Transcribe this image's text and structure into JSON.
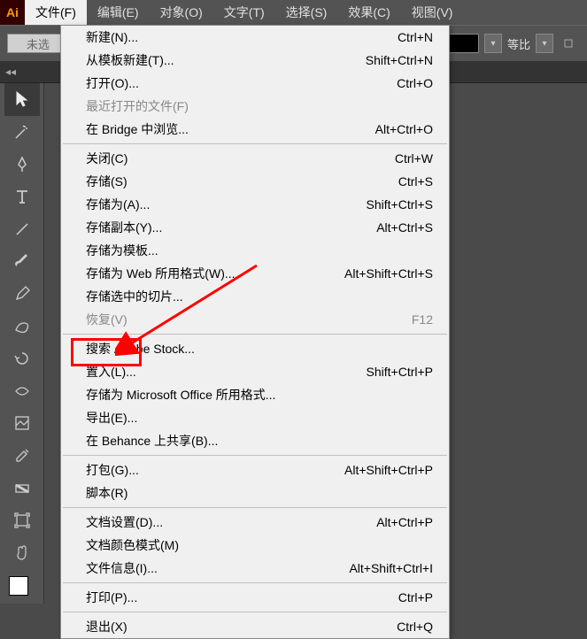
{
  "app": {
    "logo_text": "Ai"
  },
  "menubar": {
    "items": [
      {
        "label": "文件(F)",
        "active": true
      },
      {
        "label": "编辑(E)"
      },
      {
        "label": "对象(O)"
      },
      {
        "label": "文字(T)"
      },
      {
        "label": "选择(S)"
      },
      {
        "label": "效果(C)"
      },
      {
        "label": "视图(V)"
      }
    ]
  },
  "options_bar": {
    "left_label": "未选",
    "ratio_label": "等比",
    "dropdown_glyph": "▾"
  },
  "doc_tab_strip": {
    "chev": "◂◂"
  },
  "file_menu": {
    "groups": [
      [
        {
          "label": "新建(N)...",
          "shortcut": "Ctrl+N"
        },
        {
          "label": "从模板新建(T)...",
          "shortcut": "Shift+Ctrl+N"
        },
        {
          "label": "打开(O)...",
          "shortcut": "Ctrl+O"
        },
        {
          "label": "最近打开的文件(F)",
          "shortcut": "",
          "disabled": true
        },
        {
          "label": "在 Bridge 中浏览...",
          "shortcut": "Alt+Ctrl+O"
        }
      ],
      [
        {
          "label": "关闭(C)",
          "shortcut": "Ctrl+W"
        },
        {
          "label": "存储(S)",
          "shortcut": "Ctrl+S"
        },
        {
          "label": "存储为(A)...",
          "shortcut": "Shift+Ctrl+S"
        },
        {
          "label": "存储副本(Y)...",
          "shortcut": "Alt+Ctrl+S"
        },
        {
          "label": "存储为模板...",
          "shortcut": ""
        },
        {
          "label": "存储为 Web 所用格式(W)...",
          "shortcut": "Alt+Shift+Ctrl+S"
        },
        {
          "label": "存储选中的切片...",
          "shortcut": ""
        },
        {
          "label": "恢复(V)",
          "shortcut": "F12",
          "disabled": true
        }
      ],
      [
        {
          "label": "搜索 Adobe Stock...",
          "shortcut": ""
        },
        {
          "label": "置入(L)...",
          "shortcut": "Shift+Ctrl+P",
          "highlighted": true
        },
        {
          "label": "存储为 Microsoft Office 所用格式...",
          "shortcut": ""
        },
        {
          "label": "导出(E)...",
          "shortcut": ""
        },
        {
          "label": "在 Behance 上共享(B)...",
          "shortcut": ""
        }
      ],
      [
        {
          "label": "打包(G)...",
          "shortcut": "Alt+Shift+Ctrl+P"
        },
        {
          "label": "脚本(R)",
          "shortcut": ""
        }
      ],
      [
        {
          "label": "文档设置(D)...",
          "shortcut": "Alt+Ctrl+P"
        },
        {
          "label": "文档颜色模式(M)",
          "shortcut": ""
        },
        {
          "label": "文件信息(I)...",
          "shortcut": "Alt+Shift+Ctrl+I"
        }
      ],
      [
        {
          "label": "打印(P)...",
          "shortcut": "Ctrl+P"
        }
      ],
      [
        {
          "label": "退出(X)",
          "shortcut": "Ctrl+Q"
        }
      ]
    ]
  },
  "tools": [
    "selection",
    "magic-wand",
    "pen",
    "type",
    "line-segment",
    "paintbrush",
    "pencil",
    "blob-brush",
    "rotate",
    "width",
    "image-trace",
    "eyedropper",
    "gradient",
    "artboard",
    "hand"
  ]
}
